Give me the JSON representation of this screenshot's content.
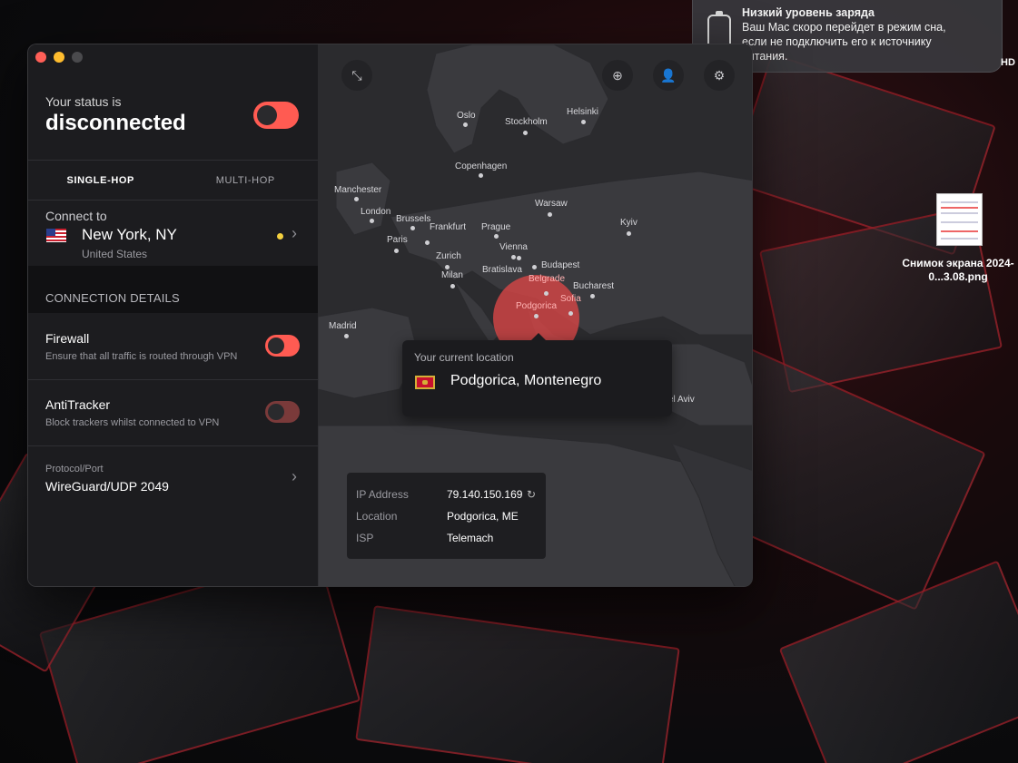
{
  "notification": {
    "title": "Низкий уровень заряда",
    "body": "Ваш Mac скоро перейдет в режим сна, если не подключить его к источнику питания."
  },
  "desktop": {
    "hd_label": "HD",
    "file_label": "Снимок экрана 2024-0...3.08.png"
  },
  "app": {
    "status": {
      "label": "Your status is",
      "value": "disconnected",
      "toggle_on": false
    },
    "tabs": [
      {
        "label": "SINGLE-HOP",
        "active": true
      },
      {
        "label": "MULTI-HOP",
        "active": false
      }
    ],
    "connect": {
      "label": "Connect to",
      "city": "New York, NY",
      "country": "United States"
    },
    "details_header": "CONNECTION DETAILS",
    "settings": {
      "firewall": {
        "title": "Firewall",
        "subtitle": "Ensure that all traffic is routed through VPN",
        "enabled": false
      },
      "antitracker": {
        "title": "AntiTracker",
        "subtitle": "Block trackers whilst connected to VPN",
        "enabled": false
      }
    },
    "protocol": {
      "label": "Protocol/Port",
      "value": "WireGuard/UDP 2049"
    }
  },
  "map": {
    "cities": [
      "Oslo",
      "Stockholm",
      "Helsinki",
      "Copenhagen",
      "Manchester",
      "London",
      "Brussels",
      "Frankfurt",
      "Prague",
      "Warsaw",
      "Kyiv",
      "Paris",
      "Zurich",
      "Vienna",
      "Bratislava",
      "Budapest",
      "Milan",
      "Belgrade",
      "Bucharest",
      "Podgorica",
      "Sofia",
      "Madrid",
      "el Aviv"
    ],
    "current_location": {
      "label": "Your current location",
      "city": "Podgorica, Montenegro"
    },
    "info": {
      "ip_label": "IP Address",
      "ip_value": "79.140.150.169",
      "location_label": "Location",
      "location_value": "Podgorica, ME",
      "isp_label": "ISP",
      "isp_value": "Telemach"
    }
  },
  "colors": {
    "accent_red": "#ff5b52",
    "indicator_yellow": "#f4d03f"
  }
}
